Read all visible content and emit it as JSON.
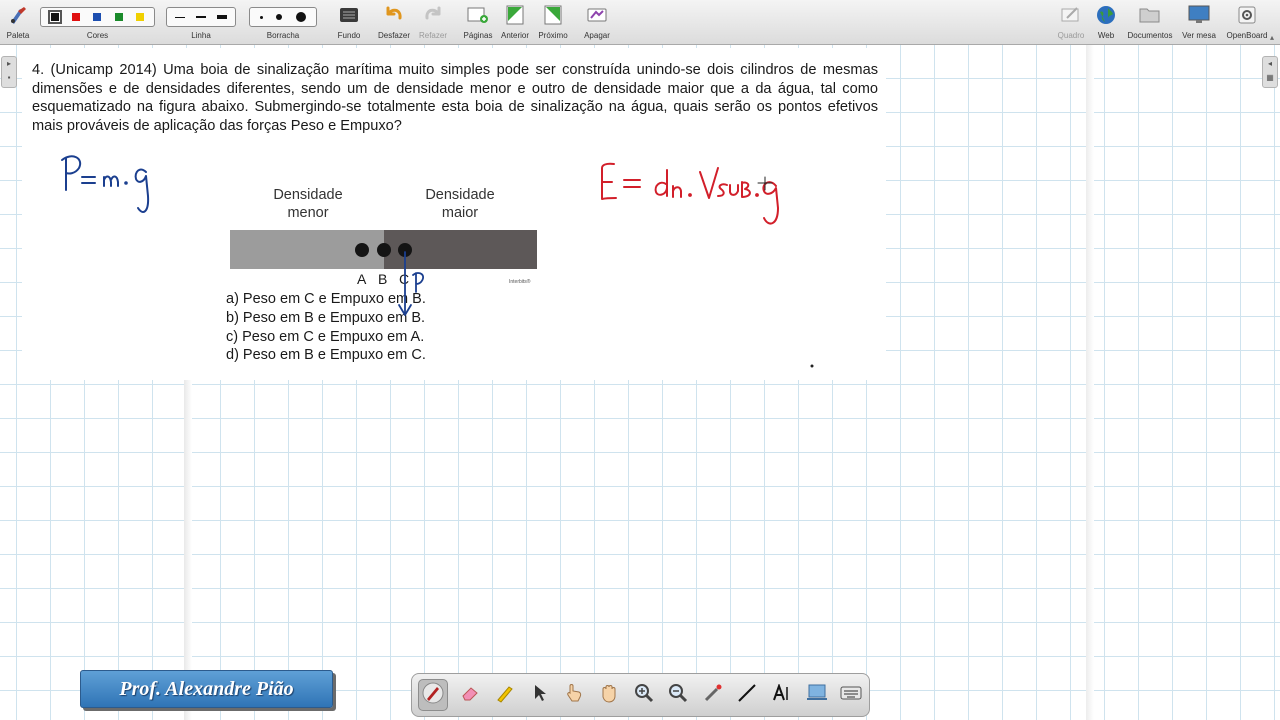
{
  "toolbar": {
    "paleta": "Paleta",
    "cores": "Cores",
    "linha": "Linha",
    "borracha": "Borracha",
    "fundo": "Fundo",
    "desfazer": "Desfazer",
    "refazer": "Refazer",
    "paginas": "Páginas",
    "anterior": "Anterior",
    "proximo": "Próximo",
    "apagar": "Apagar",
    "quadro": "Quadro",
    "web": "Web",
    "documentos": "Documentos",
    "ver_mesa": "Ver mesa",
    "openboard": "OpenBoard",
    "colors": [
      "#111111",
      "#e01010",
      "#1d4fb0",
      "#1a8a2a",
      "#f0d000"
    ]
  },
  "document": {
    "question": "4. (Unicamp 2014)  Uma boia de sinalização marítima muito simples pode ser construída unindo-se dois cilindros de mesmas dimensões e de densidades diferentes, sendo um de densidade menor e outro de densidade maior que a da água, tal como esquematizado na figura abaixo. Submergindo-se totalmente esta boia de sinalização na água, quais serão os pontos efetivos mais prováveis de aplicação das forças Peso e Empuxo?",
    "figure": {
      "label_left": "Densidade\nmenor",
      "label_right": "Densidade\nmaior",
      "points": [
        "A",
        "B",
        "C"
      ],
      "credit": "Interbits®"
    },
    "options": [
      "a) Peso em C e Empuxo em B.",
      "b) Peso em B e Empuxo em B.",
      "c) Peso em C e Empuxo em A.",
      "d) Peso em B e Empuxo em C."
    ]
  },
  "annotations": {
    "ink_blue": "#1b3f8f",
    "ink_red": "#d21f2a"
  },
  "signature": "Prof. Alexandre Pião"
}
